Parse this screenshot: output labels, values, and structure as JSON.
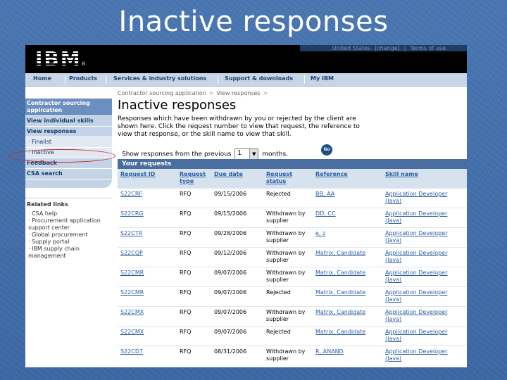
{
  "slide": {
    "title": "Inactive responses"
  },
  "masthead": {
    "logo": "IBM",
    "logo_mark": "®",
    "country": "United States",
    "change": "[change]",
    "divider": "|",
    "terms": "Terms of use"
  },
  "nav": [
    "Home",
    "Products",
    "Services & industry solutions",
    "Support & downloads",
    "My IBM"
  ],
  "leftnav": {
    "app": "Contractor sourcing application",
    "view_skills": "View individual skills",
    "view_responses": "View responses",
    "finalist": "· Finalist",
    "inactive": "· Inactive",
    "feedback": "Feedback",
    "csa_search": "CSA search"
  },
  "related": {
    "title": "Related links",
    "items": [
      "· CSA help",
      "· Procurement application support center",
      "· Global procurement",
      "· Supply portal",
      "· IBM supply chain management"
    ]
  },
  "breadcrumb": [
    "Contractor sourcing application",
    "View responses"
  ],
  "breadcrumb_sep": ">",
  "page": {
    "title": "Inactive responses",
    "description": "Responses which have been withdrawn by you or rejected by the client are shown here. Click the request number to view that request, the reference to view that response, or the skill name to view that skill."
  },
  "filter": {
    "prefix": "Show responses from the previous",
    "value": "1",
    "suffix": "months.",
    "go_label": "Go"
  },
  "requests": {
    "title": "Your requests",
    "columns": [
      "Request ID",
      "Request type",
      "Due date",
      "Request status",
      "Reference",
      "Skill name"
    ],
    "rows": [
      [
        "S22CRF",
        "RFQ",
        "09/15/2006",
        "Rejected",
        "BB, AA",
        "Application Developer (Java)"
      ],
      [
        "S22CRG",
        "RFQ",
        "09/15/2006",
        "Withdrawn by supplier",
        "DD, CC",
        "Application Developer (Java)"
      ],
      [
        "S22CTR",
        "RFQ",
        "09/28/2006",
        "Withdrawn by supplier",
        "e, z",
        "Application Developer (Java)"
      ],
      [
        "S22CQP",
        "RFQ",
        "09/12/2006",
        "Withdrawn by supplier",
        "Matrix, Candidate",
        "Application Developer (Java)"
      ],
      [
        "S22CMR",
        "RFQ",
        "09/07/2006",
        "Withdrawn by supplier",
        "Matrix, Candidate",
        "Application Developer (Java)"
      ],
      [
        "S22CMR",
        "RFQ",
        "09/07/2006",
        "Rejected",
        "Matrix, Candidate",
        "Application Developer (Java)"
      ],
      [
        "S22CMX",
        "RFQ",
        "09/07/2006",
        "Withdrawn by supplier",
        "Matrix, Candidate",
        "Application Developer (Java)"
      ],
      [
        "S22CMX",
        "RFQ",
        "09/07/2006",
        "Rejected",
        "Matrix, Candidate",
        "Application Developer (Java)"
      ],
      [
        "S22CD7",
        "RFQ",
        "08/31/2006",
        "Withdrawn by supplier",
        "R, ANAND",
        "Application Developer (Java)"
      ]
    ]
  },
  "colors": {
    "slide_bg": "#3e6aa6",
    "link": "#2a5ea8",
    "nav_bg": "#c8d5e7",
    "header_bar": "#4a6e9f",
    "highlight_oval": "#c62a2a"
  }
}
